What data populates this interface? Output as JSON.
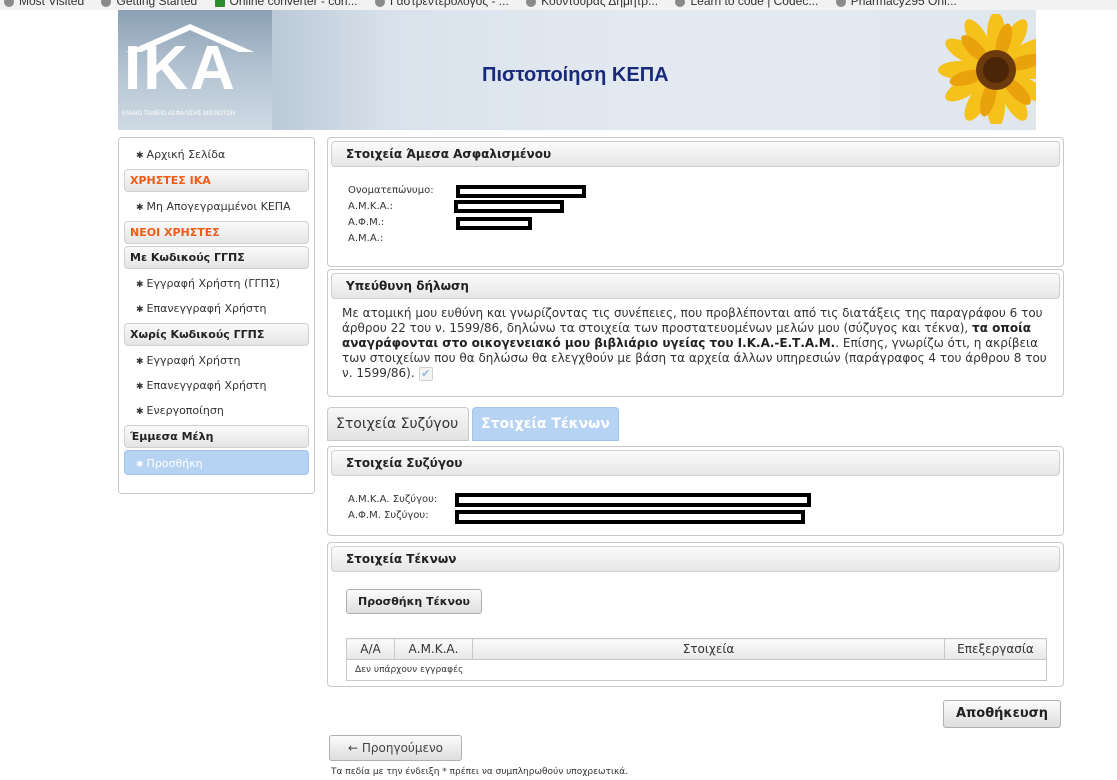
{
  "bookmarks": [
    "Most Visited",
    "Getting Started",
    "Online converter - con...",
    "Γαστρεντερολόγος - ...",
    "Κουντούρας Δημήτρ...",
    "Learn to code | Codec...",
    "Pharmacy295 Onl..."
  ],
  "banner": {
    "logo": "IKA",
    "logo_subtitle": "ΕΝΙΑΙΟ ΤΑΜΕΙΟ ΑΣΦΑΛΙΣΗΣ ΜΙΣΘΩΤΩΝ",
    "title": "Πιστοποίηση ΚΕΠΑ"
  },
  "sidebar": {
    "home": "Αρχική Σελίδα",
    "ika_users_header": "ΧΡΗΣΤΕΣ ΙΚΑ",
    "unregistered_kepa": "Μη Απογεγραμμένοι ΚΕΠΑ",
    "new_users_header": "ΝΕΟΙ ΧΡΗΣΤΕΣ",
    "with_codes_header": "Με Κωδικούς ΓΓΠΣ",
    "register_ggps": "Εγγραφή Χρήστη (ΓΓΠΣ)",
    "reregister_1": "Επανεγγραφή Χρήστη",
    "without_codes_header": "Χωρίς Κωδικούς ΓΓΠΣ",
    "register": "Εγγραφή Χρήστη",
    "reregister_2": "Επανεγγραφή Χρήστη",
    "activation": "Ενεργοποίηση",
    "indirect_members_header": "Έμμεσα Μέλη",
    "add": "Προσθήκη"
  },
  "insured": {
    "title": "Στοιχεία Άμεσα Ασφαλισμένου",
    "fullname_label": "Ονοματεπώνυμο:",
    "amka_label": "Α.Μ.Κ.Α.:",
    "afm_label": "Α.Φ.Μ.:",
    "ama_label": "Α.Μ.Α.:"
  },
  "declaration": {
    "title": "Υπεύθυνη δήλωση",
    "text_1": "Με ατομική μου ευθύνη και γνωρίζοντας τις συνέπειες, που προβλέπονται από τις διατάξεις της παραγράφου 6 του άρθρου 22 του ν. 1599/86, δηλώνω τα στοιχεία των προστατευομένων μελών μου (σύζυγος και τέκνα), ",
    "text_bold": "τα οποία αναγράφονται στο οικογενειακό μου βιβλιάριο υγείας του Ι.Κ.Α.-Ε.Τ.Α.Μ.",
    "text_2": ". Επίσης, γνωρίζω ότι, η ακρίβεια των στοιχείων που θα δηλώσω θα ελεγχθούν με βάση τα αρχεία άλλων υπηρεσιών (παράγραφος 4 του άρθρου 8 του ν. 1599/86).",
    "checked": true
  },
  "tabs": {
    "spouse": "Στοιχεία Συζύγου",
    "children": "Στοιχεία Τέκνων"
  },
  "spouse": {
    "title": "Στοιχεία Συζύγου",
    "amka_label": "Α.Μ.Κ.Α. Συζύγου:",
    "afm_label": "Α.Φ.Μ. Συζύγου:"
  },
  "children": {
    "title": "Στοιχεία Τέκνων",
    "add_button": "Προσθήκη Τέκνου",
    "columns": [
      "Α/Α",
      "Α.Μ.Κ.Α.",
      "Στοιχεία",
      "Επεξεργασία"
    ],
    "empty_text": "Δεν υπάρχουν εγγραφές"
  },
  "actions": {
    "save": "Αποθήκευση",
    "previous": "Προηγούμενο",
    "previous_arrow": "←"
  },
  "footnote": "Τα πεδία με την ένδειξη * πρέπει να συμπληρωθούν υποχρεωτικά."
}
